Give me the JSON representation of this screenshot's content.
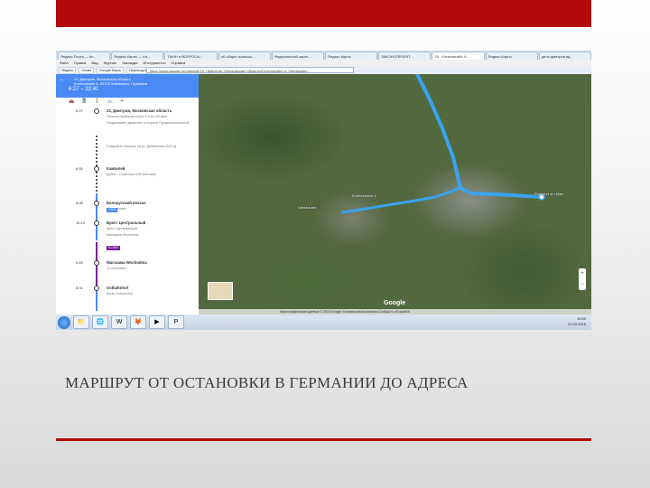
{
  "slide": {
    "caption": "МАРШРУТ ОТ ОСТАНОВКИ В ГЕРМАНИИ ДО АДРЕСА",
    "accent_color": "#b30b0b"
  },
  "browser": {
    "tabs": [
      "Яндекс.Почта — Кп...",
      "Яндекс.Карты — Кв...",
      "ТАМН в ВОПРОСЫ...",
      "об общих промыш...",
      "Федеральный закон...",
      "Яндекс Карты",
      "ЗАКОНОПРОЕКТ...",
      "23 - Kontorstraße 4...",
      "Яндекс.Карты",
      "дело дмитров ад..."
    ],
    "menu": [
      "Файл",
      "Правка",
      "Вид",
      "Журнал",
      "Закладки",
      "Инструменты",
      "Справка"
    ],
    "bookmarks": [
      "Яндекс",
      "Gmail",
      "Google Maps",
      "Переводчик"
    ],
    "url": "https://www.google.ru/maps/dir/23,+Дмитров,+Московская+область/Kontorstraße+4,+Wiesbaden"
  },
  "sidebar": {
    "from": "23, Дмитров, Московская область",
    "to": "Kontorstraße 4, 65178 Wiesbaden, Германия",
    "time_range": "6:27 – 22:41",
    "modes": [
      "car-icon",
      "transit-icon",
      "walk-icon",
      "bike-icon",
      "plane-icon"
    ],
    "steps": [
      {
        "time": "6:27",
        "name": "23, Дмитров, Московская область",
        "sub": "Пешком приблизительно 2,5 км (30 мин)"
      },
      {
        "time": "",
        "name": "",
        "sub": "Продолжайте движение в сторону Профессиональной"
      },
      {
        "time": "",
        "name": "",
        "sub": "Поверните направо на ул. Дубненская (500 м)"
      },
      {
        "time": "6:55",
        "name": "Камзелей",
        "sub": "Дубна – Савёлово  6:55 (Москва)"
      },
      {
        "time": "8:08",
        "name": "Белорусский вокзал",
        "sub": "17 остановок"
      },
      {
        "time": "10:12",
        "name": "Брест Центральный",
        "sub": "Брест-Центральный"
      },
      {
        "time": "",
        "name": "",
        "sub": "Warszawa Wschodnia"
      },
      {
        "time": "9:45",
        "name": "Warszawa Wschodnia",
        "sub": "10 остановок"
      },
      {
        "time": "8:31",
        "name": "Ostbahnhof",
        "sub": "Berlin Ostbahnhof"
      }
    ],
    "badges": [
      {
        "label": "7029",
        "color": "#4a8af4"
      },
      {
        "label": "EC/EN",
        "color": "#7b1fa2"
      }
    ]
  },
  "map": {
    "labels": [
      "Kontorstraße 4",
      "Wiesbaden",
      "Frankfurt am Main"
    ],
    "logo": "Google",
    "footer": "Картографические данные © 2015 Google   Условия использования   Сообщить об ошибке"
  },
  "taskbar": {
    "apps": [
      "folder-icon",
      "explorer-icon",
      "word-icon",
      "firefox-icon",
      "media-icon",
      "powerpoint-icon"
    ],
    "time": "19:55",
    "date": "21.03.2016"
  }
}
